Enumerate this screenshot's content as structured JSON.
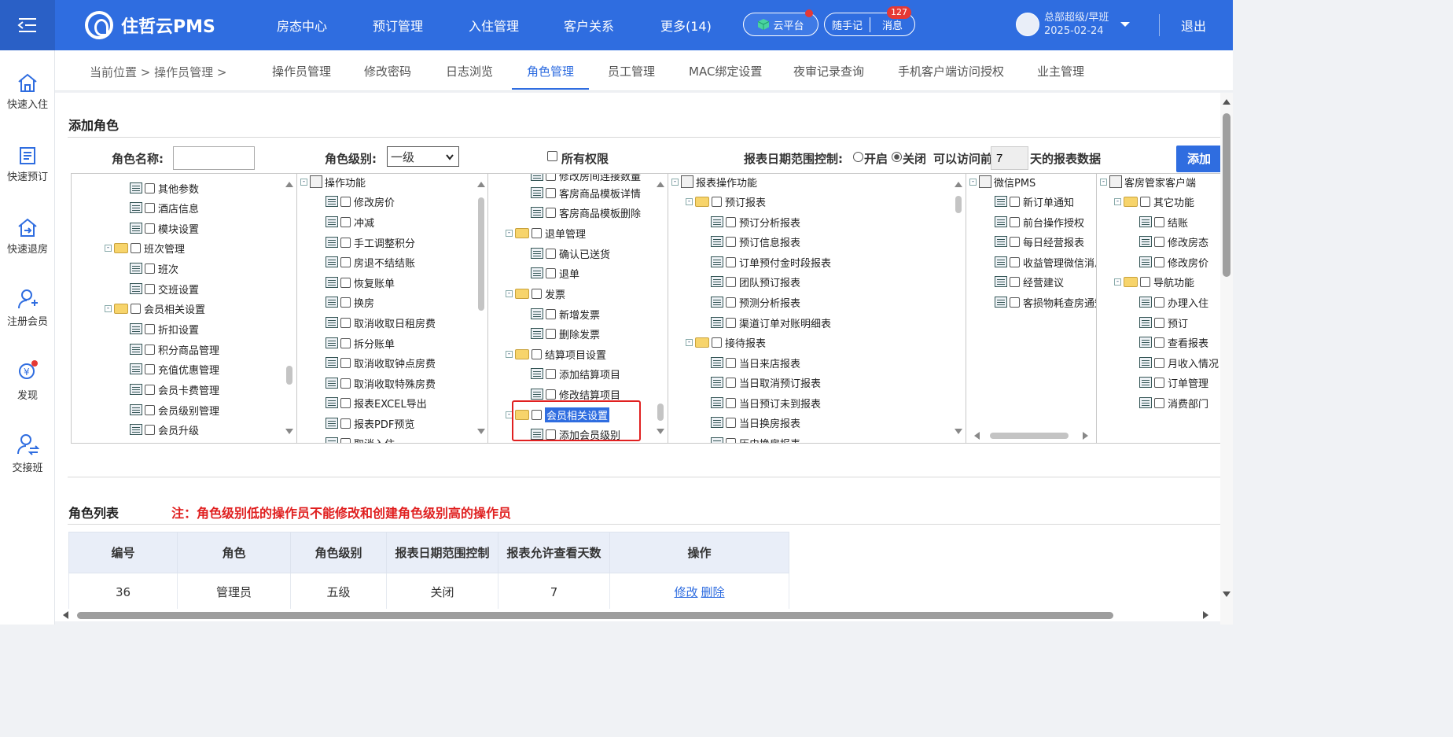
{
  "app": {
    "logo_text": "住哲云PMS"
  },
  "topnav": {
    "items": [
      "房态中心",
      "预订管理",
      "入住管理",
      "客户关系",
      "更多(14)"
    ]
  },
  "toolbar": {
    "cloud_label": "云平台",
    "note_label": "随手记",
    "msg_label": "消息",
    "msg_count": "127"
  },
  "user": {
    "name": "总部超级/早班",
    "date": "2025-02-24",
    "logout": "退出"
  },
  "sidebar": {
    "items": [
      {
        "label": "快速入住",
        "icon": "home-icon"
      },
      {
        "label": "快速预订",
        "icon": "document-icon"
      },
      {
        "label": "快速退房",
        "icon": "checkout-icon"
      },
      {
        "label": "注册会员",
        "icon": "add-user-icon"
      },
      {
        "label": "发现",
        "icon": "discover-icon"
      },
      {
        "label": "交接班",
        "icon": "shift-handover-icon"
      }
    ]
  },
  "breadcrumb": {
    "text": "当前位置 > 操作员管理 >"
  },
  "tabs": [
    "操作员管理",
    "修改密码",
    "日志浏览",
    "角色管理",
    "员工管理",
    "MAC绑定设置",
    "夜审记录查询",
    "手机客户端访问授权",
    "业主管理"
  ],
  "add_role": {
    "title": "添加角色",
    "name_label": "角色名称:",
    "name_value": "",
    "level_label": "角色级别:",
    "level_value": "一级",
    "all_perm_label": "所有权限",
    "report_ctrl_label": "报表日期范围控制:",
    "radio_on": "开启",
    "radio_off": "关闭",
    "days_prefix": "可以访问前",
    "days_value": "7",
    "days_suffix": "天的报表数据",
    "add_button": "添加角色"
  },
  "trees": {
    "col1": [
      "其他参数",
      "酒店信息",
      "模块设置",
      "班次管理",
      "班次",
      "交班设置",
      "会员相关设置",
      "折扣设置",
      "积分商品管理",
      "充值优惠管理",
      "会员卡费管理",
      "会员级别管理",
      "会员升级"
    ],
    "col2": [
      "操作功能",
      "修改房价",
      "冲减",
      "手工调整积分",
      "房退不结结账",
      "恢复账单",
      "换房",
      "取消收取日租房费",
      "拆分账单",
      "取消收取钟点房费",
      "取消收取特殊房费",
      "报表EXCEL导出",
      "报表PDF预览",
      "取消入住"
    ],
    "col3": [
      "修改房间连接数量",
      "客房商品模板详情",
      "客房商品模板删除",
      "退单管理",
      "确认已送货",
      "退单",
      "发票",
      "新增发票",
      "删除发票",
      "结算项目设置",
      "添加结算项目",
      "修改结算项目",
      "会员相关设置",
      "添加会员级别"
    ],
    "col4": [
      "报表操作功能",
      "预订报表",
      "预订分析报表",
      "预订信息报表",
      "订单预付金时段报表",
      "团队预订报表",
      "预测分析报表",
      "渠道订单对账明细表",
      "接待报表",
      "当日来店报表",
      "当日取消预订报表",
      "当日预订未到报表",
      "当日换房报表",
      "历史换房报表"
    ],
    "col5": [
      "微信PMS",
      "新订单通知",
      "前台操作授权",
      "每日经营报表",
      "收益管理微信消息",
      "经营建议",
      "客损物耗查房通知"
    ],
    "col6": [
      "客房管家客户端",
      "其它功能",
      "结账",
      "修改房态",
      "修改房价",
      "导航功能",
      "办理入住",
      "预订",
      "查看报表",
      "月收入情况",
      "订单管理",
      "消费部门"
    ]
  },
  "role_list": {
    "title": "角色列表",
    "note": "注：角色级别低的操作员不能修改和创建角色级别高的操作员",
    "headers": [
      "编号",
      "角色",
      "角色级别",
      "报表日期范围控制",
      "报表允许查看天数",
      "操作"
    ],
    "rows": [
      {
        "id": "36",
        "role": "管理员",
        "level": "五级",
        "ctrl": "关闭",
        "days": "7",
        "edit": "修改",
        "delete": "删除"
      }
    ]
  },
  "colors": {
    "primary": "#2f6de0",
    "danger": "#e02020",
    "header_bg": "#e9eef8"
  }
}
